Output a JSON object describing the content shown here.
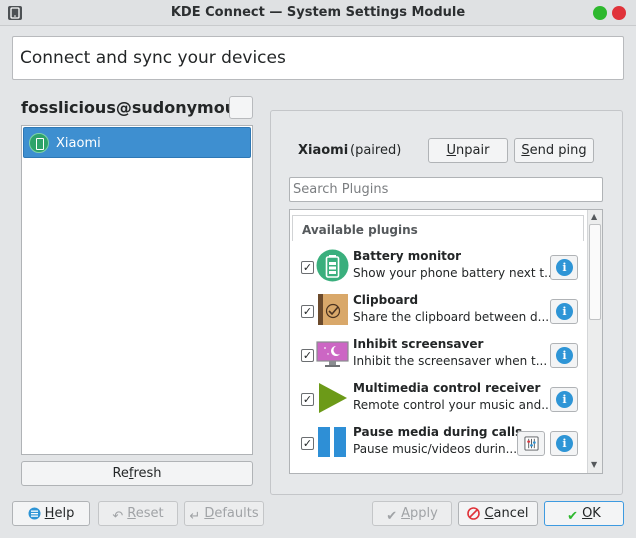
{
  "window": {
    "title": "KDE Connect — System Settings Module"
  },
  "header": {
    "text": "Connect and sync your devices"
  },
  "host": {
    "name": "fosslicious@sudonymous"
  },
  "devices": [
    {
      "label": "Xiaomi"
    }
  ],
  "refresh": {
    "label_pre": "Re",
    "label_mn": "f",
    "label_post": "resh"
  },
  "device": {
    "name": "Xiaomi",
    "status": "(paired)",
    "unpair": {
      "mn": "U",
      "rest": "npair"
    },
    "ping": {
      "mn": "S",
      "rest": "end ping"
    }
  },
  "search": {
    "placeholder": "Search Plugins"
  },
  "plugins": {
    "heading": "Available plugins",
    "items": [
      {
        "name": "Battery monitor",
        "desc": "Show your phone battery next t...",
        "checked": "✓",
        "icon": "battery-icon"
      },
      {
        "name": "Clipboard",
        "desc": "Share the clipboard between d...",
        "checked": "✓",
        "icon": "clipboard-icon"
      },
      {
        "name": "Inhibit screensaver",
        "desc": "Inhibit the screensaver when t...",
        "checked": "✓",
        "icon": "screensaver-icon"
      },
      {
        "name": "Multimedia control receiver",
        "desc": "Remote control your music and...",
        "checked": "✓",
        "icon": "play-icon"
      },
      {
        "name": "Pause media during calls",
        "desc": "Pause music/videos durin...",
        "checked": "✓",
        "icon": "pause-icon"
      }
    ]
  },
  "footer": {
    "help": {
      "mn": "H",
      "rest": "elp"
    },
    "reset": {
      "mn": "R",
      "rest": "eset"
    },
    "defaults": {
      "mn": "D",
      "rest": "efaults"
    },
    "apply": {
      "mn": "A",
      "rest": "pply"
    },
    "cancel": {
      "mn": "C",
      "rest": "ancel"
    },
    "ok": {
      "mn": "O",
      "rest": "K"
    }
  },
  "colors": {
    "selection": "#3e8fd0",
    "accent": "#3d9ae0",
    "info": "#2e95d6",
    "close": "#e0333a",
    "maximize": "#2eb82e"
  }
}
